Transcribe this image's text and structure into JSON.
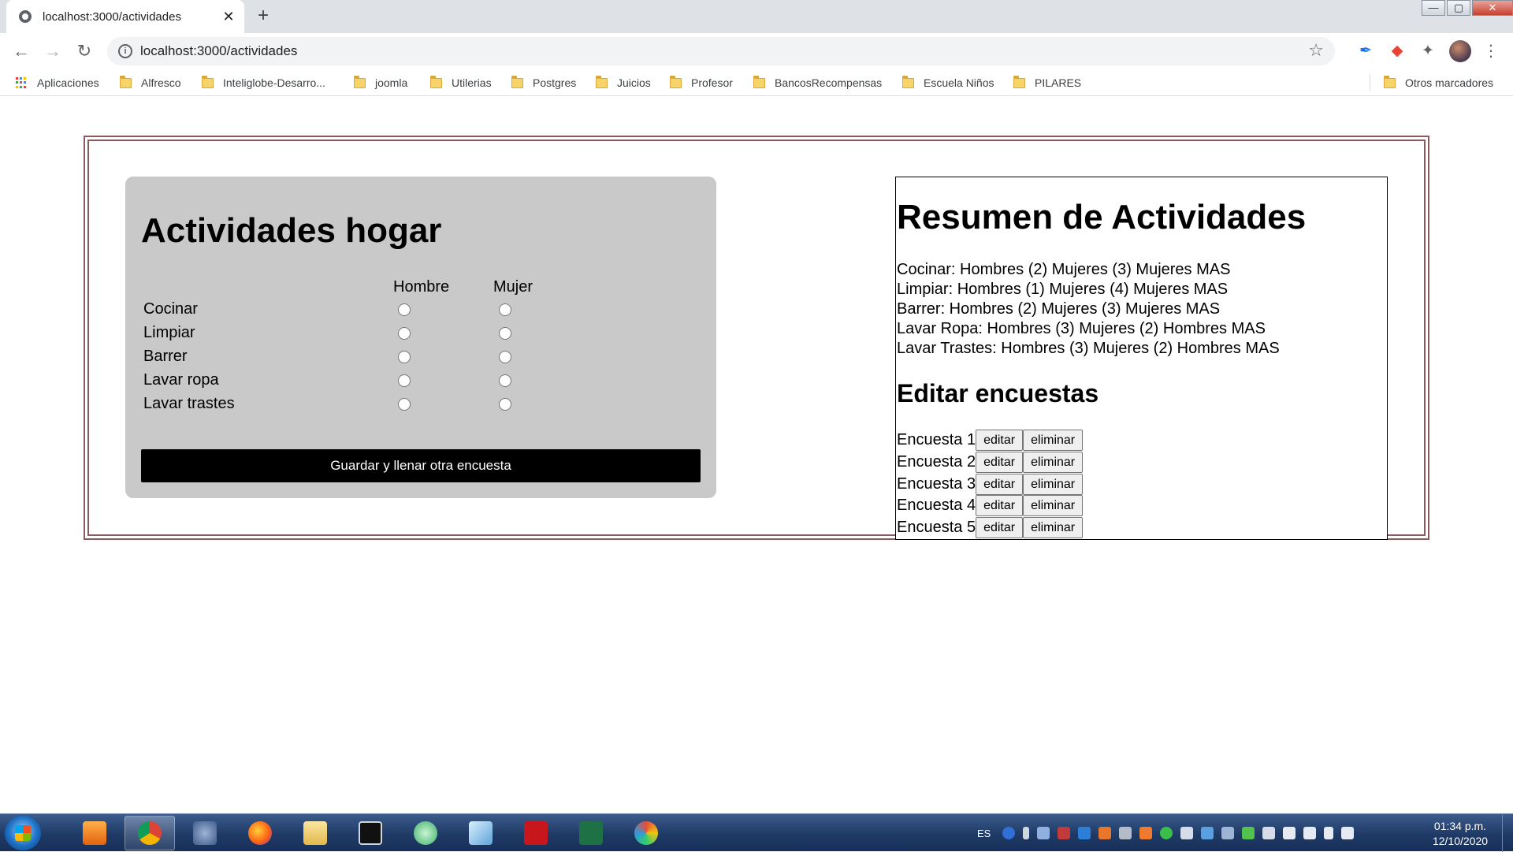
{
  "browser": {
    "tab_title": "localhost:3000/actividades",
    "tab_close": "✕",
    "new_tab": "+",
    "url": "localhost:3000/actividades",
    "window_controls": {
      "minimize": "—",
      "maximize": "▢",
      "close": "✕"
    }
  },
  "bookmarks": {
    "apps_label": "Aplicaciones",
    "items": [
      "Alfresco",
      "Inteliglobe-Desarro...",
      "joomla",
      "Utilerias",
      "Postgres",
      "Juicios",
      "Profesor",
      "BancosRecompensas",
      "Escuela Niños",
      "PILARES"
    ],
    "other": "Otros marcadores"
  },
  "form": {
    "title": "Actividades hogar",
    "col_hombre": "Hombre",
    "col_mujer": "Mujer",
    "activities": [
      "Cocinar",
      "Limpiar",
      "Barrer",
      "Lavar ropa",
      "Lavar trastes"
    ],
    "save_button": "Guardar y llenar otra encuesta"
  },
  "summary": {
    "title": "Resumen de Actividades",
    "lines": [
      "Cocinar: Hombres (2) Mujeres (3) Mujeres MAS",
      "Limpiar: Hombres (1) Mujeres (4) Mujeres MAS",
      "Barrer: Hombres (2) Mujeres (3) Mujeres MAS",
      "Lavar Ropa: Hombres (3) Mujeres (2) Hombres MAS",
      "Lavar Trastes: Hombres (3) Mujeres (2) Hombres MAS"
    ],
    "edit_title": "Editar encuestas",
    "surveys": [
      "Encuesta 1",
      "Encuesta 2",
      "Encuesta 3",
      "Encuesta 4",
      "Encuesta 5"
    ],
    "edit_label": "editar",
    "delete_label": "eliminar"
  },
  "taskbar": {
    "lang": "ES",
    "time": "01:34 p.m.",
    "date": "12/10/2020"
  }
}
